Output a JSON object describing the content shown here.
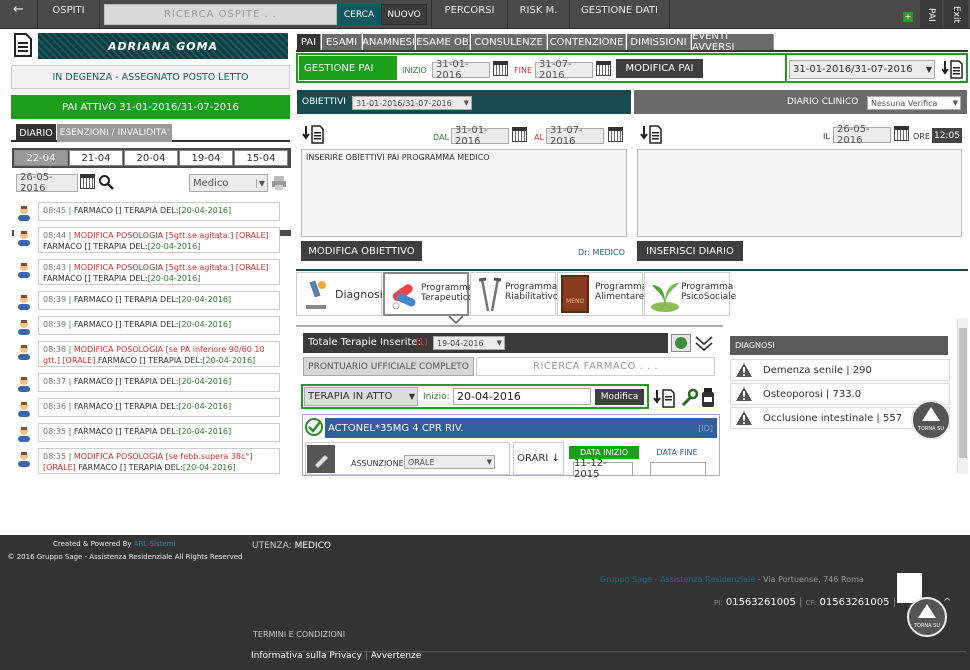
{
  "topbar": {
    "back": "←",
    "ospiti": "OSPITI",
    "search_placeholder": "RICERCA OSPITE . .",
    "cerca": "CERCA",
    "nuovo": "NUOVO",
    "percorsi": "PERCORSI",
    "risk": "RISK M.",
    "gestione": "GESTIONE DATI",
    "pai": "PAI",
    "exit": "Exit"
  },
  "left": {
    "patient_name": "ADRIANA GOMA",
    "status": "IN DEGENZA - ASSEGNATO POSTO LETTO",
    "pai_attivo": "PAI ATTIVO 31-01-2016/31-07-2016",
    "tabs": [
      "DIARIO",
      "ESENZIONI / INVALIDITA'"
    ],
    "days": [
      "22-04",
      "21-04",
      "20-04",
      "19-04",
      "15-04"
    ],
    "date": "26-05-2016",
    "filter": "Medico",
    "events": [
      {
        "time": "08:45",
        "type": "",
        "text": "FARMACO [] TERAPIA DEL:",
        "date": "[20-04-2016]"
      },
      {
        "time": "08:44",
        "type": "MODIFICA POSOLOGIA [5gtt.se agitata.] [ORALE]",
        "text": "FARMACO [] TERAPIA DEL:",
        "date": "[20-04-2016]"
      },
      {
        "time": "08:43",
        "type": "MODIFICA POSOLOGIA [5gtt.se agitata.] [ORALE]",
        "text": "FARMACO [] TERAPIA DEL:",
        "date": "[20-04-2016]"
      },
      {
        "time": "08:39",
        "type": "",
        "text": "FARMACO [] TERAPIA DEL:",
        "date": "[20-04-2016]"
      },
      {
        "time": "08:39",
        "type": "",
        "text": "FARMACO [] TERAPIA DEL:",
        "date": "[20-04-2016]"
      },
      {
        "time": "08:38",
        "type": "MODIFICA POSOLOGIA [se PA inferiore 90/60 10 gtt.] [ORALE]",
        "text": "FARMACO [] TERAPIA DEL:",
        "date": "[20-04-2016]"
      },
      {
        "time": "08:37",
        "type": "",
        "text": "FARMACO [] TERAPIA DEL:",
        "date": "[20-04-2016]"
      },
      {
        "time": "08:36",
        "type": "",
        "text": "FARMACO [] TERAPIA DEL:",
        "date": "[20-04-2016]"
      },
      {
        "time": "08:35",
        "type": "",
        "text": "FARMACO [] TERAPIA DEL:",
        "date": "[20-04-2016]"
      },
      {
        "time": "08:35",
        "type": "MODIFICA POSOLOGIA [se febb.supera 38c°] [ORALE]",
        "text": "FARMACO [] TERAPIA DEL:",
        "date": "[20-04-2016]"
      }
    ]
  },
  "right": {
    "tabs": [
      "PAI",
      "ESAMI",
      "ANAMNESI",
      "ESAME OB",
      "CONSULENZE",
      "CONTENZIONE",
      "DIMISSIONI",
      "EVENTI AVVERSI"
    ],
    "gestione_pai": "GESTIONE PAI",
    "inizio_lbl": "INIZIO",
    "inizio": "31-01-2016",
    "fine_lbl": "FINE",
    "fine": "31-07-2016",
    "modifica_pai": "MODIFICA PAI",
    "pai_select": "31-01-2016/31-07-2016",
    "obiettivi": "OBIETTIVI",
    "obiettivi_select": "31-01-2016/31-07-2016",
    "dal_lbl": "DAL",
    "dal": "31-01-2016",
    "al_lbl": "AL",
    "al": "31-07-2016",
    "obiettivi_text": "INSERIRE OBIETTIVI PAI PROGRAMMA MEDICO",
    "modifica_obiettivo": "MODIFICA OBIETTIVO",
    "dr": "Dr: MEDICO",
    "diario": "DIARIO CLINICO",
    "diario_select": "Nessuna Verifica",
    "il_lbl": "IL",
    "il": "26-05-2016",
    "ore_lbl": "ORE",
    "ore": "12:05",
    "inserisci": "INSERISCI DIARIO",
    "programs": [
      "Diagnosi",
      "Programma Terapeutico",
      "Programma Riabilitativo",
      "Programma Alimentare",
      "Programma PsicoSociale"
    ],
    "menu_label": "MENU",
    "totale": "Totale Terapie Inserite:",
    "totale_n": "(1)",
    "totale_date": "19-04-2016",
    "prontuario": "PRONTUARIO UFFICIALE COMPLETO",
    "ricerca_farmaco": "RICERCA FARMACO . . .",
    "terapia_sel": "TERAPIA IN ATTO",
    "inizio2_lbl": "Inizio:",
    "inizio2": "20-04-2016",
    "modifica": "Modifica",
    "farmaco": "ACTONEL*35MG 4 CPR RIV.",
    "farmaco_code": "[ID]",
    "assunzione_lbl": "ASSUNZIONE",
    "assunzione": "ORALE",
    "orari": "ORARI ↓",
    "data_inizio_lbl": "DATA INIZIO",
    "data_inizio": "11-12-2015",
    "data_fine_lbl": "DATA FINE",
    "diagnosi_hdr": "DIAGNOSI",
    "diagnosi": [
      "Demenza senile | 290",
      "Osteoporosi | 733.0",
      "Occlusione intestinale | 557"
    ],
    "torna_su": "TORNA SU"
  },
  "footer": {
    "created": "Created & Powered By",
    "brand": "ARL Sistemi",
    "copy": "© 2016 Gruppo Sage - Assistenza Residenziale All Rights Reserved",
    "utenza_lbl": "UTENZA:",
    "utenza": "MEDICO",
    "company": "Gruppo Sage - Assistenza Residenziale",
    "address": " - Via Portuense, 746 Roma",
    "pi_lbl": "PI:",
    "pi": "01563261005",
    "cf_lbl": "CF:",
    "cf": "01563261005",
    "termini": "TERMINI E CONDIZIONI",
    "privacy": "Informativa sulla Privacy",
    "avvertenze": "Avvertenze",
    "torna_su": "TORNA SU"
  },
  "colors": {
    "green": "#1b9f1b",
    "teal": "#11595e",
    "dark": "#4a4a4a"
  }
}
